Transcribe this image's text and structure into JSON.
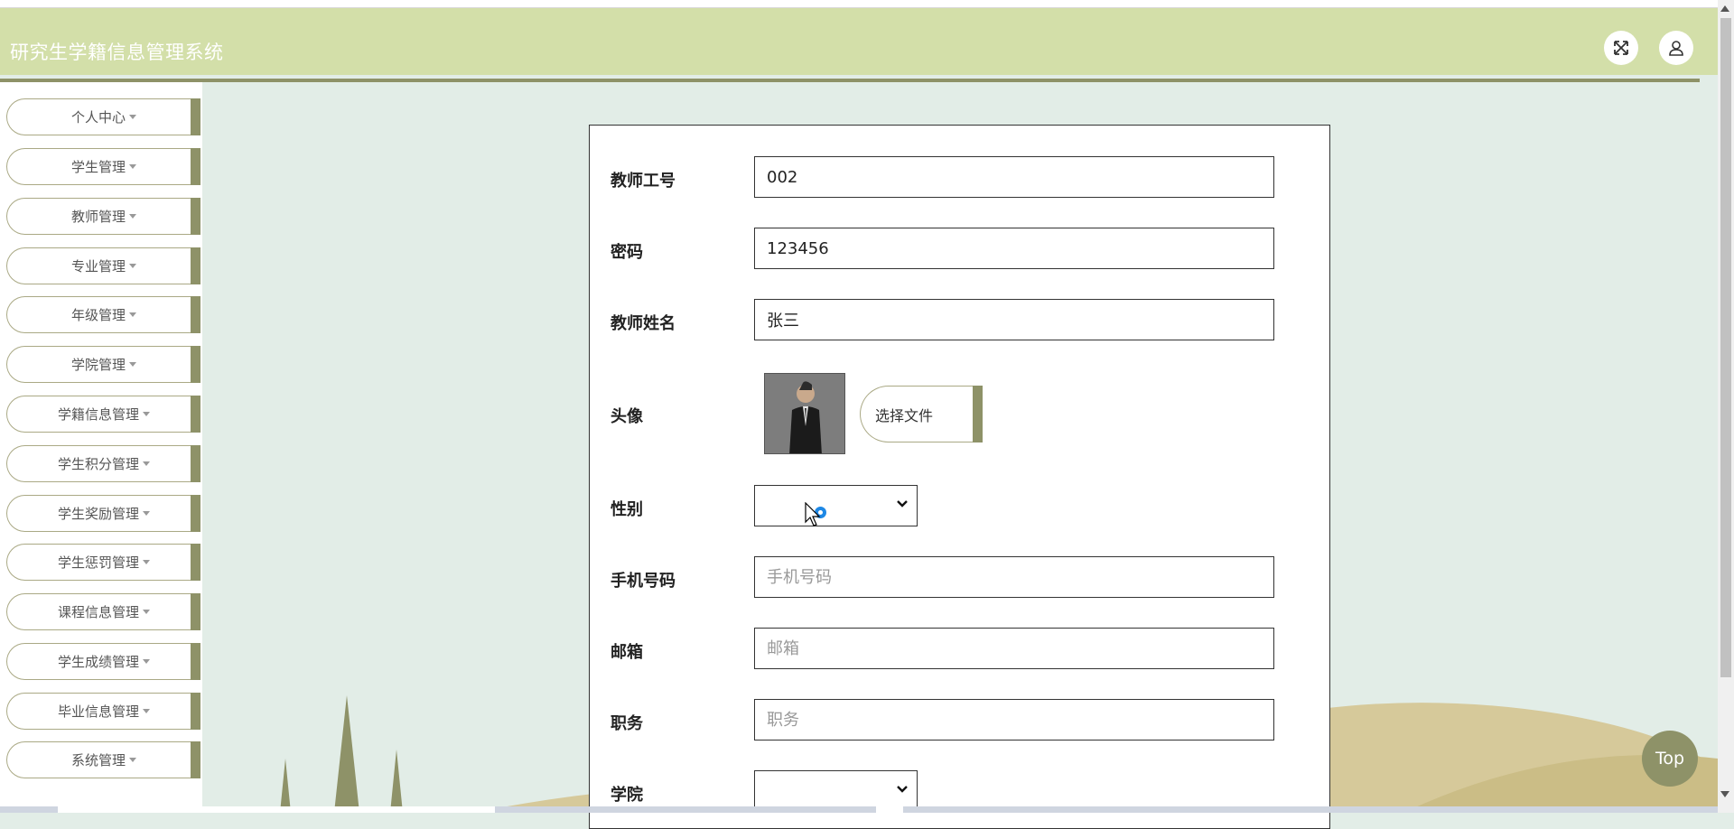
{
  "header": {
    "title": "研究生学籍信息管理系统",
    "fullscreen_icon": "expand-arrows-icon",
    "user_icon": "user-icon"
  },
  "sidebar": {
    "items": [
      {
        "label": "个人中心"
      },
      {
        "label": "学生管理"
      },
      {
        "label": "教师管理"
      },
      {
        "label": "专业管理"
      },
      {
        "label": "年级管理"
      },
      {
        "label": "学院管理"
      },
      {
        "label": "学籍信息管理"
      },
      {
        "label": "学生积分管理"
      },
      {
        "label": "学生奖励管理"
      },
      {
        "label": "学生惩罚管理"
      },
      {
        "label": "课程信息管理"
      },
      {
        "label": "学生成绩管理"
      },
      {
        "label": "毕业信息管理"
      },
      {
        "label": "系统管理"
      }
    ]
  },
  "form": {
    "teacher_id": {
      "label": "教师工号",
      "value": "002"
    },
    "password": {
      "label": "密码",
      "value": "123456"
    },
    "teacher_name": {
      "label": "教师姓名",
      "value": "张三"
    },
    "avatar": {
      "label": "头像",
      "upload_label": "选择文件"
    },
    "gender": {
      "label": "性别",
      "value": ""
    },
    "phone": {
      "label": "手机号码",
      "placeholder": "手机号码",
      "value": ""
    },
    "email": {
      "label": "邮箱",
      "placeholder": "邮箱",
      "value": ""
    },
    "position": {
      "label": "职务",
      "placeholder": "职务",
      "value": ""
    },
    "college": {
      "label": "学院",
      "value": ""
    }
  },
  "top_button": {
    "label": "Top"
  },
  "colors": {
    "header_bg": "#d3dfa9",
    "accent": "#8e9268",
    "page_bg": "#e2ede7"
  }
}
